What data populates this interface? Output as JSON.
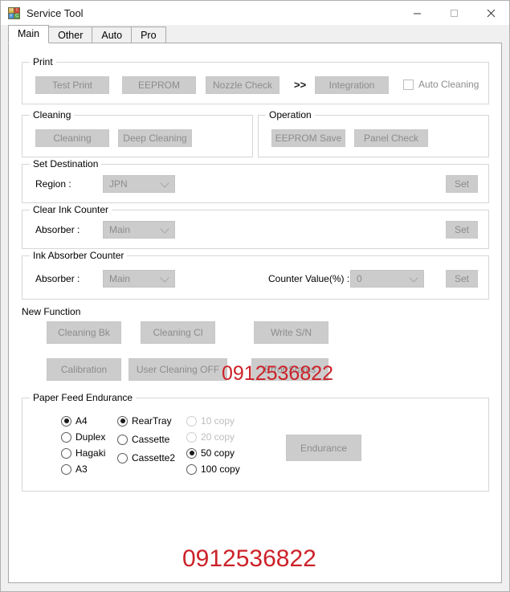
{
  "window": {
    "title": "Service Tool",
    "icon": "app-blocks-icon",
    "controls": {
      "minimize": "—",
      "maximize": "☐",
      "close": "✕"
    }
  },
  "tabs": [
    {
      "label": "Main",
      "active": true
    },
    {
      "label": "Other",
      "active": false
    },
    {
      "label": "Auto",
      "active": false
    },
    {
      "label": "Pro",
      "active": false
    }
  ],
  "print": {
    "legend": "Print",
    "buttons": [
      "Test Print",
      "EEPROM",
      "Nozzle Check",
      "Integration"
    ],
    "separator": ">>",
    "checkbox": {
      "label": "Auto Cleaning",
      "checked": false
    }
  },
  "cleaning": {
    "legend": "Cleaning",
    "buttons": [
      "Cleaning",
      "Deep Cleaning"
    ]
  },
  "operation": {
    "legend": "Operation",
    "buttons": [
      "EEPROM Save",
      "Panel Check"
    ]
  },
  "set_destination": {
    "legend": "Set Destination",
    "field_label": "Region :",
    "value": "JPN",
    "set_label": "Set"
  },
  "clear_ink_counter": {
    "legend": "Clear Ink Counter",
    "field_label": "Absorber :",
    "value": "Main",
    "set_label": "Set"
  },
  "ink_absorber_counter": {
    "legend": "Ink Absorber Counter",
    "field_label": "Absorber :",
    "value": "Main",
    "counter_label": "Counter Value(%) :",
    "counter_value": "0",
    "set_label": "Set"
  },
  "new_function": {
    "legend": "New Function",
    "buttons": [
      "Cleaning Bk",
      "Cleaning Cl",
      "Write S/N",
      "Calibration",
      "User Cleaning OFF",
      "Error Status"
    ]
  },
  "paper_feed_endurance": {
    "legend": "Paper Feed Endurance",
    "paper_size": [
      {
        "label": "A4",
        "checked": true,
        "disabled": false
      },
      {
        "label": "Duplex",
        "checked": false,
        "disabled": false
      },
      {
        "label": "Hagaki",
        "checked": false,
        "disabled": false
      },
      {
        "label": "A3",
        "checked": false,
        "disabled": false
      }
    ],
    "feed_source": [
      {
        "label": "RearTray",
        "checked": true,
        "disabled": false
      },
      {
        "label": "Cassette",
        "checked": false,
        "disabled": false
      },
      {
        "label": "Cassette2",
        "checked": false,
        "disabled": false
      }
    ],
    "copies": [
      {
        "label": "10 copy",
        "checked": false,
        "disabled": true
      },
      {
        "label": "20 copy",
        "checked": false,
        "disabled": true
      },
      {
        "label": "50 copy",
        "checked": true,
        "disabled": false
      },
      {
        "label": "100 copy",
        "checked": false,
        "disabled": false
      }
    ],
    "endurance_button": "Endurance"
  },
  "watermarks": {
    "middle": "0912536822",
    "bottom": "0912536822",
    "color": "#cc2229"
  }
}
